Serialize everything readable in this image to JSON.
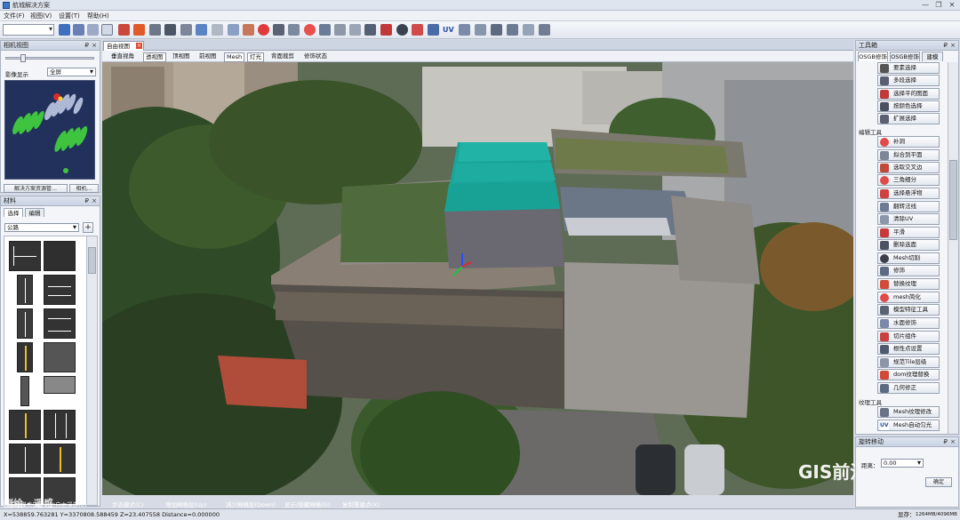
{
  "window": {
    "title": "航城解决方案",
    "minimize": "—",
    "maximize": "❐",
    "close": "✕"
  },
  "menu": [
    "文件(F)",
    "视图(V)",
    "设置(T)",
    "帮助(H)"
  ],
  "toolbar": {
    "uv_label": "UV"
  },
  "camera_panel": {
    "title": "相机视图",
    "pin": "₽",
    "close": "×",
    "display_label": "影像显示",
    "display_value": "全屏",
    "bottom_tabs": [
      "解决方案资源管…",
      "相机…"
    ]
  },
  "material_panel": {
    "title": "材料",
    "pin": "₽",
    "close": "×",
    "tabs": [
      "选择",
      "编辑"
    ],
    "category": "公路",
    "add_button": "+"
  },
  "document": {
    "tab_label": "自由视图",
    "tab_close": "×",
    "view_tabs": [
      "垂直视角",
      "透视图",
      "顶视图",
      "前视图",
      "Mesh",
      "灯光",
      "背面裁剪",
      "修饰状态"
    ],
    "active_view": "透视图"
  },
  "toolbox": {
    "title": "工具箱",
    "pin": "₽",
    "close": "×",
    "tabs": [
      "OSGB修饰",
      "OSGB修饰",
      "建模"
    ],
    "select_tools": [
      "要素选择",
      "多段选择",
      "选择平的图面",
      "按颜色选择",
      "扩展选择"
    ],
    "edit_section": "编辑工具",
    "edit_tools": [
      "补洞",
      "拟合到平面",
      "选取交叉边",
      "三角细分",
      "选择悬浮物",
      "翻转法线",
      "清除UV",
      "平滑",
      "删除选面",
      "Mesh切割",
      "修饰",
      "替换纹理",
      "mesh简化",
      "模型特征工具",
      "水面修饰",
      "切片组件",
      "根性点设置",
      "规范Tile层级",
      "dom纹理替换",
      "几何修正"
    ],
    "texture_section": "纹理工具",
    "texture_tools": [
      "Mesh纹理修改",
      "Mesh自动匀光"
    ]
  },
  "move_panel": {
    "title": "旋转移动",
    "pin": "₽",
    "close": "×",
    "distance_label": "距离：",
    "distance_value": "0.00",
    "confirm": "确定"
  },
  "status": {
    "tabs": [
      "□选择模式(s)",
      "□自由漫游(C)",
      "步态模式(C)",
      "增加网格层(Up)",
      "减少网格层(Down)",
      "显示/隐藏网格(G)",
      "复制重建点(X)"
    ],
    "coords": "X=538859.763281   Y=3370808.588459   Z=23.407558   Distance=0.000000",
    "memory_label": "显存：",
    "memory_value": "1264MB/4096MB"
  },
  "watermark": {
    "text": "GIS前沿",
    "left_text": "测绘 · 遥感"
  },
  "colors": {
    "accent": "#3a77c8",
    "selected": "#ffffff",
    "panel": "#f3f5f9"
  }
}
